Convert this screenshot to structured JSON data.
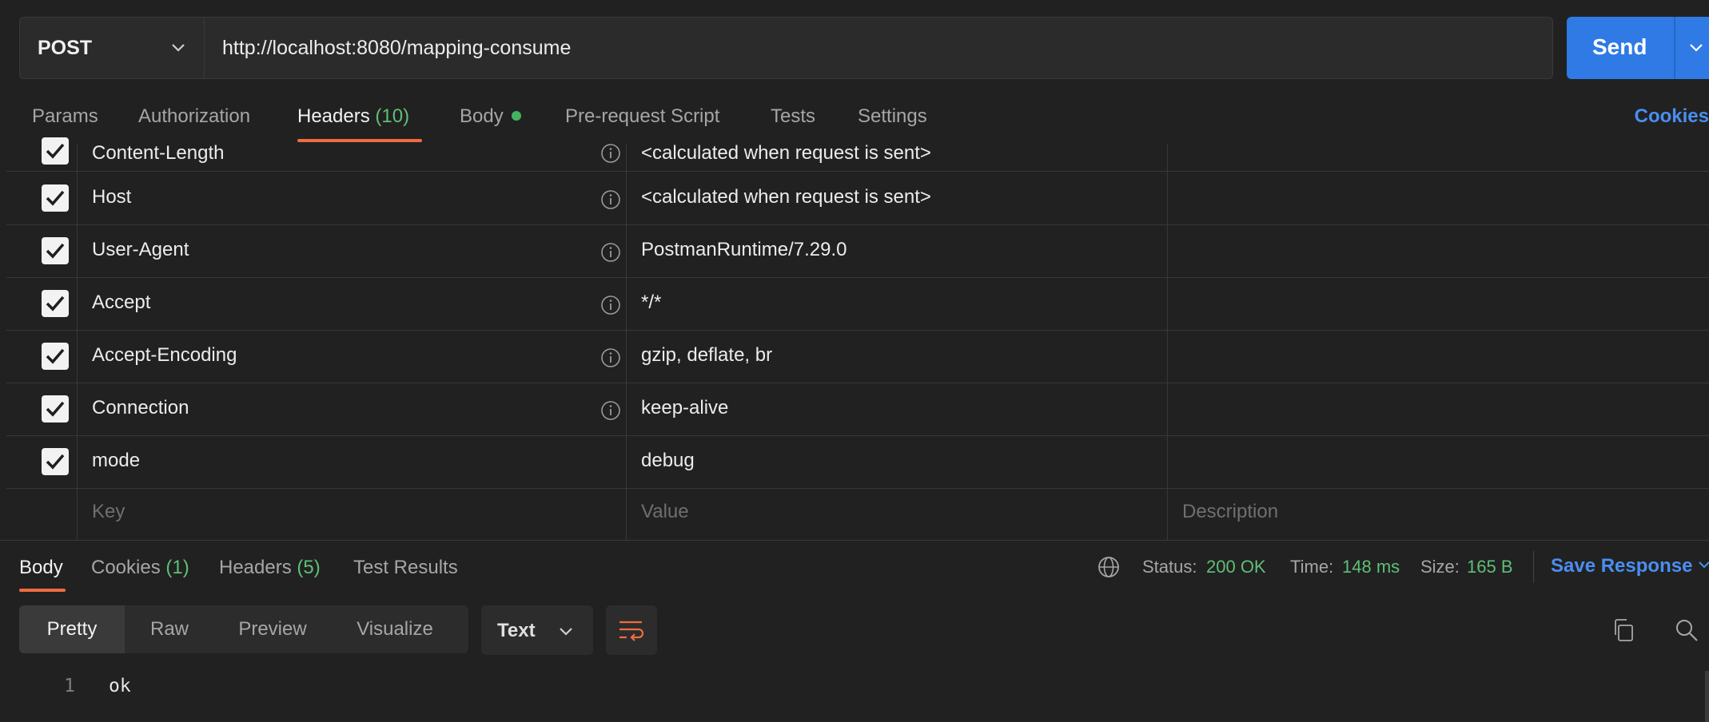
{
  "request": {
    "method": "POST",
    "url": "http://localhost:8080/mapping-consume",
    "send_label": "Send"
  },
  "request_tabs": {
    "params": "Params",
    "authorization": "Authorization",
    "headers": "Headers",
    "headers_count": "(10)",
    "body": "Body",
    "pre_request": "Pre-request Script",
    "tests": "Tests",
    "settings": "Settings",
    "cookies": "Cookies"
  },
  "headers_table": {
    "rows": [
      {
        "key": "Content-Length",
        "value": "<calculated when request is sent>"
      },
      {
        "key": "Host",
        "value": "<calculated when request is sent>"
      },
      {
        "key": "User-Agent",
        "value": "PostmanRuntime/7.29.0"
      },
      {
        "key": "Accept",
        "value": "*/*"
      },
      {
        "key": "Accept-Encoding",
        "value": "gzip, deflate, br"
      },
      {
        "key": "Connection",
        "value": "keep-alive"
      },
      {
        "key": "mode",
        "value": "debug"
      }
    ],
    "placeholder_key": "Key",
    "placeholder_value": "Value",
    "placeholder_description": "Description"
  },
  "response_tabs": {
    "body": "Body",
    "cookies": "Cookies",
    "cookies_count": "(1)",
    "headers": "Headers",
    "headers_count": "(5)",
    "test_results": "Test Results"
  },
  "response_status": {
    "status_label": "Status:",
    "status_value": "200 OK",
    "time_label": "Time:",
    "time_value": "148 ms",
    "size_label": "Size:",
    "size_value": "165 B",
    "save_response": "Save Response"
  },
  "view_modes": {
    "pretty": "Pretty",
    "raw": "Raw",
    "preview": "Preview",
    "visualize": "Visualize",
    "format": "Text"
  },
  "response_body": {
    "line_number": "1",
    "content": "ok"
  },
  "colors": {
    "accent_blue": "#2f7ae5",
    "accent_orange": "#ee6d3f",
    "success_green": "#5fbf77"
  }
}
